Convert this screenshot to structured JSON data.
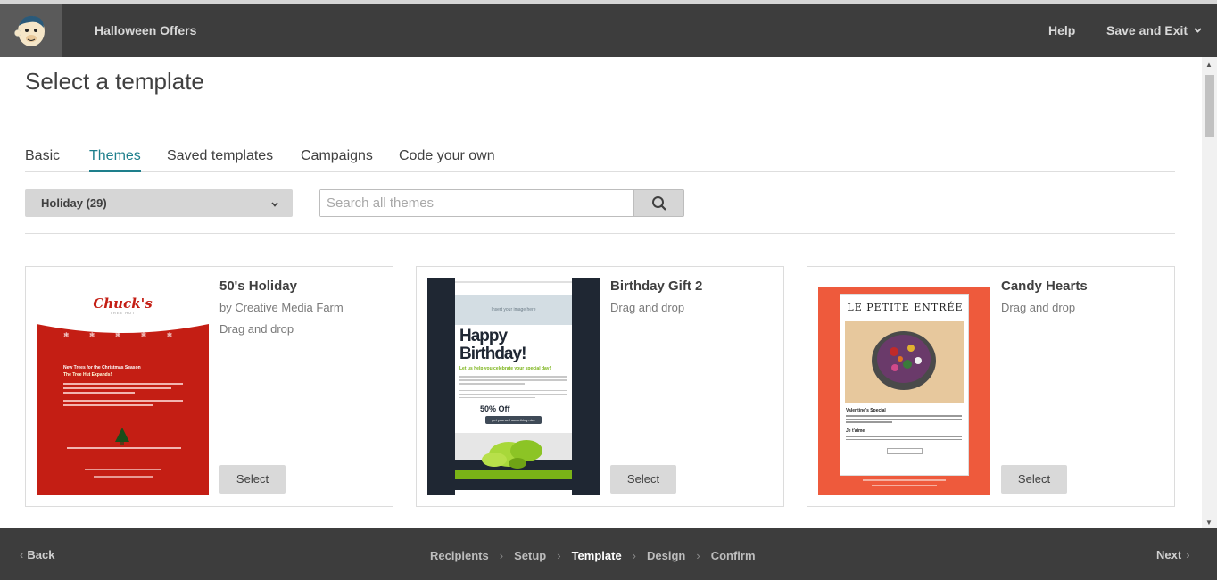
{
  "header": {
    "campaign_name": "Halloween Offers",
    "help_label": "Help",
    "save_exit_label": "Save and Exit"
  },
  "page_title": "Select a template",
  "tabs": [
    {
      "label": "Basic",
      "active": false
    },
    {
      "label": "Themes",
      "active": true
    },
    {
      "label": "Saved templates",
      "active": false
    },
    {
      "label": "Campaigns",
      "active": false
    },
    {
      "label": "Code your own",
      "active": false
    }
  ],
  "filter": {
    "category_value": "Holiday (29)",
    "search_placeholder": "Search all themes"
  },
  "templates": [
    {
      "title": "50's Holiday",
      "author": "by Creative Media Farm",
      "type": "Drag and drop",
      "select_label": "Select",
      "thumb": {
        "logo": "Chuck's",
        "logo_sub": "TREE HUT",
        "heading": "New Trees for the Christmas Season",
        "subheading": "The Tree Hut Expands!"
      }
    },
    {
      "title": "Birthday Gift 2",
      "type": "Drag and drop",
      "select_label": "Select",
      "thumb": {
        "image_placeholder": "Insert your image here",
        "headline": "Happy Birthday!",
        "tagline": "Let us help you celebrate your special day!",
        "offer": "50% Off",
        "offer_button": "get yourself something nice"
      }
    },
    {
      "title": "Candy Hearts",
      "type": "Drag and drop",
      "select_label": "Select",
      "thumb": {
        "logo": "LE PETITE ENTRÉE",
        "heading": "Valentine's Special",
        "subheading": "Je t'aime"
      }
    }
  ],
  "footer": {
    "back_label": "Back",
    "next_label": "Next",
    "steps": [
      {
        "label": "Recipients",
        "current": false
      },
      {
        "label": "Setup",
        "current": false
      },
      {
        "label": "Template",
        "current": true
      },
      {
        "label": "Design",
        "current": false
      },
      {
        "label": "Confirm",
        "current": false
      }
    ]
  },
  "colors": {
    "topbar": "#3d3d3d",
    "accent": "#1e7f8c",
    "button": "#d9d9d9"
  }
}
